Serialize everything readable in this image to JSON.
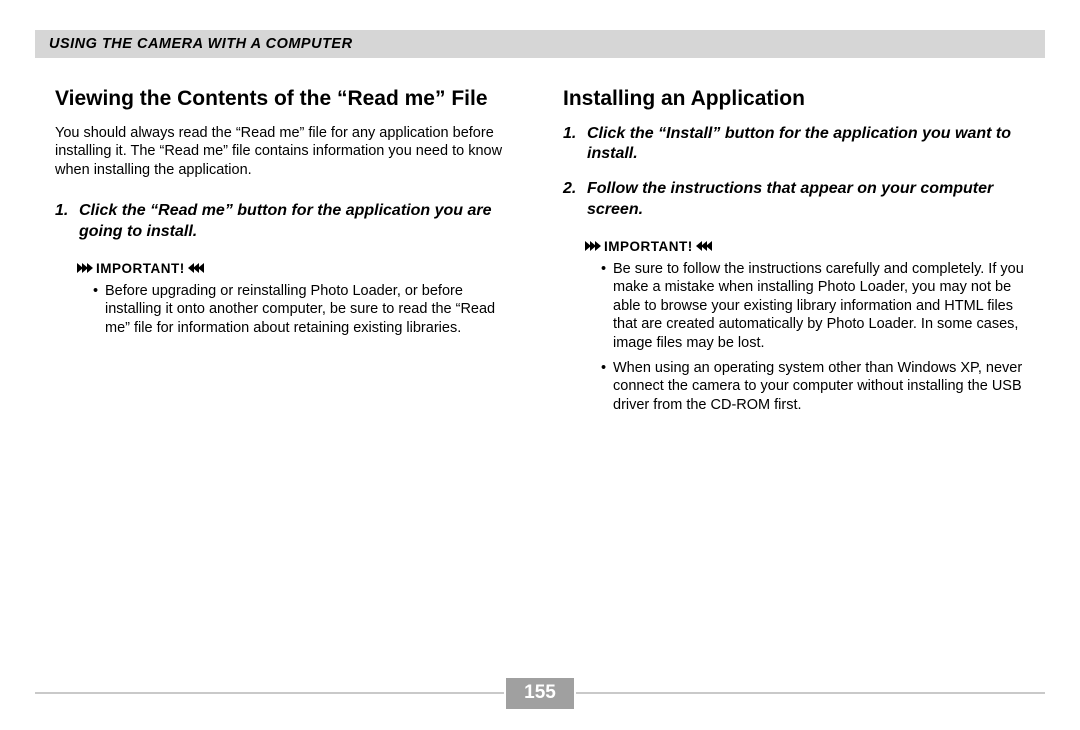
{
  "header": "USING THE CAMERA WITH A COMPUTER",
  "left": {
    "heading": "Viewing the Contents of the “Read me” File",
    "paragraph": "You should always read the “Read me” file for any application before installing it. The “Read me” file contains information you need to know when installing the application.",
    "steps": [
      "Click the “Read me” button for the application you are going to install."
    ],
    "important_label": "IMPORTANT!",
    "important_bullets": [
      "Before upgrading or reinstalling Photo Loader, or before installing it onto another computer, be sure to read the “Read me” file for information about retaining existing libraries."
    ]
  },
  "right": {
    "heading": "Installing an Application",
    "steps": [
      "Click the “Install” button for the application you want to install.",
      "Follow the instructions that appear on your computer screen."
    ],
    "important_label": "IMPORTANT!",
    "important_bullets": [
      "Be sure to follow the instructions carefully and completely. If you make a mistake when installing Photo Loader, you may not be able to browse your existing library information and HTML files that are created automatically by Photo Loader. In some cases, image files may be lost.",
      "When using an operating system other than Windows XP, never connect the camera to your computer without installing the USB driver from the CD-ROM first."
    ]
  },
  "page_number": "155"
}
